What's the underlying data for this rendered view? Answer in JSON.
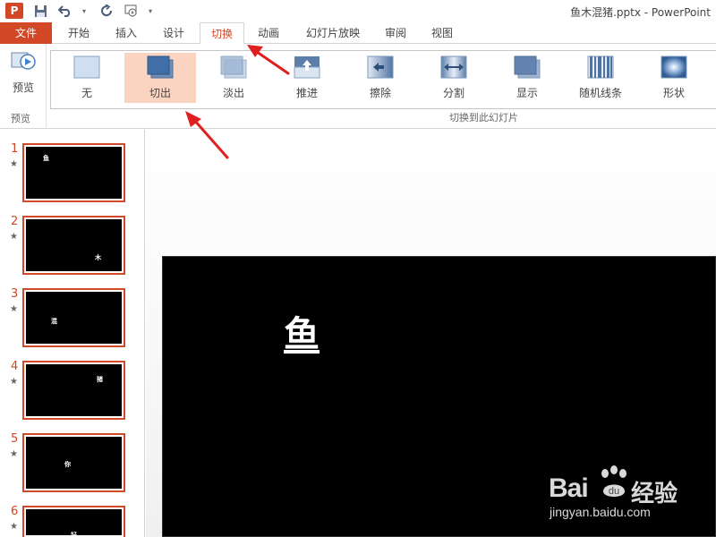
{
  "window": {
    "title": "鱼木混猪.pptx - PowerPoint"
  },
  "app": {
    "logo": "P"
  },
  "tabs": [
    {
      "label": "文件"
    },
    {
      "label": "开始"
    },
    {
      "label": "插入"
    },
    {
      "label": "设计"
    },
    {
      "label": "切换"
    },
    {
      "label": "动画"
    },
    {
      "label": "幻灯片放映"
    },
    {
      "label": "审阅"
    },
    {
      "label": "视图"
    }
  ],
  "ribbon": {
    "preview": {
      "label": "预览",
      "group_label": "预览"
    },
    "gallery_group_label": "切换到此幻灯片",
    "transitions": [
      {
        "label": "无"
      },
      {
        "label": "切出"
      },
      {
        "label": "淡出"
      },
      {
        "label": "推进"
      },
      {
        "label": "擦除"
      },
      {
        "label": "分割"
      },
      {
        "label": "显示"
      },
      {
        "label": "随机线条"
      },
      {
        "label": "形状"
      }
    ],
    "selected_transition": "切出"
  },
  "slides": [
    {
      "number": "1",
      "char": "鱼"
    },
    {
      "number": "2",
      "char": "木"
    },
    {
      "number": "3",
      "char": "混"
    },
    {
      "number": "4",
      "char": "猪"
    },
    {
      "number": "5",
      "char": "你"
    },
    {
      "number": "6",
      "char": "好"
    }
  ],
  "thumb_star": "★",
  "current_slide": {
    "title": "鱼"
  },
  "watermark": {
    "brand": "Bai",
    "cn": "经验",
    "url": "jingyan.baidu.com"
  },
  "colors": {
    "accent": "#d24726",
    "selected_bg": "#fbd3c1",
    "annotation_arrow": "#e02020"
  }
}
